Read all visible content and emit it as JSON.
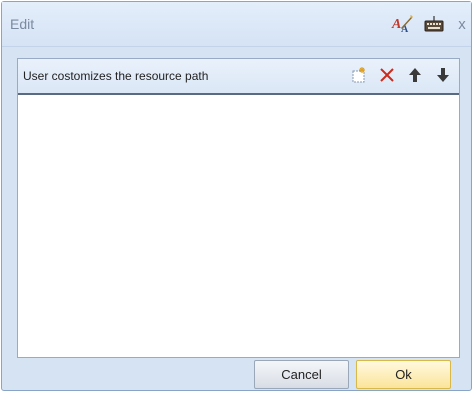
{
  "dialog": {
    "title": "Edit",
    "title_tools": [
      {
        "icon": "spell-check-icon"
      },
      {
        "icon": "keyboard-icon"
      }
    ],
    "close_label": "x"
  },
  "panel": {
    "title": "User costomizes the resource path",
    "tools": [
      {
        "icon": "new-item-icon"
      },
      {
        "icon": "delete-icon"
      },
      {
        "icon": "move-up-icon"
      },
      {
        "icon": "move-down-icon"
      }
    ],
    "items": []
  },
  "buttons": {
    "cancel": "Cancel",
    "ok": "Ok"
  },
  "colors": {
    "frame": "#d6e3f3",
    "delete_red": "#cc2a1c",
    "ok_highlight": "#fbe49a"
  }
}
